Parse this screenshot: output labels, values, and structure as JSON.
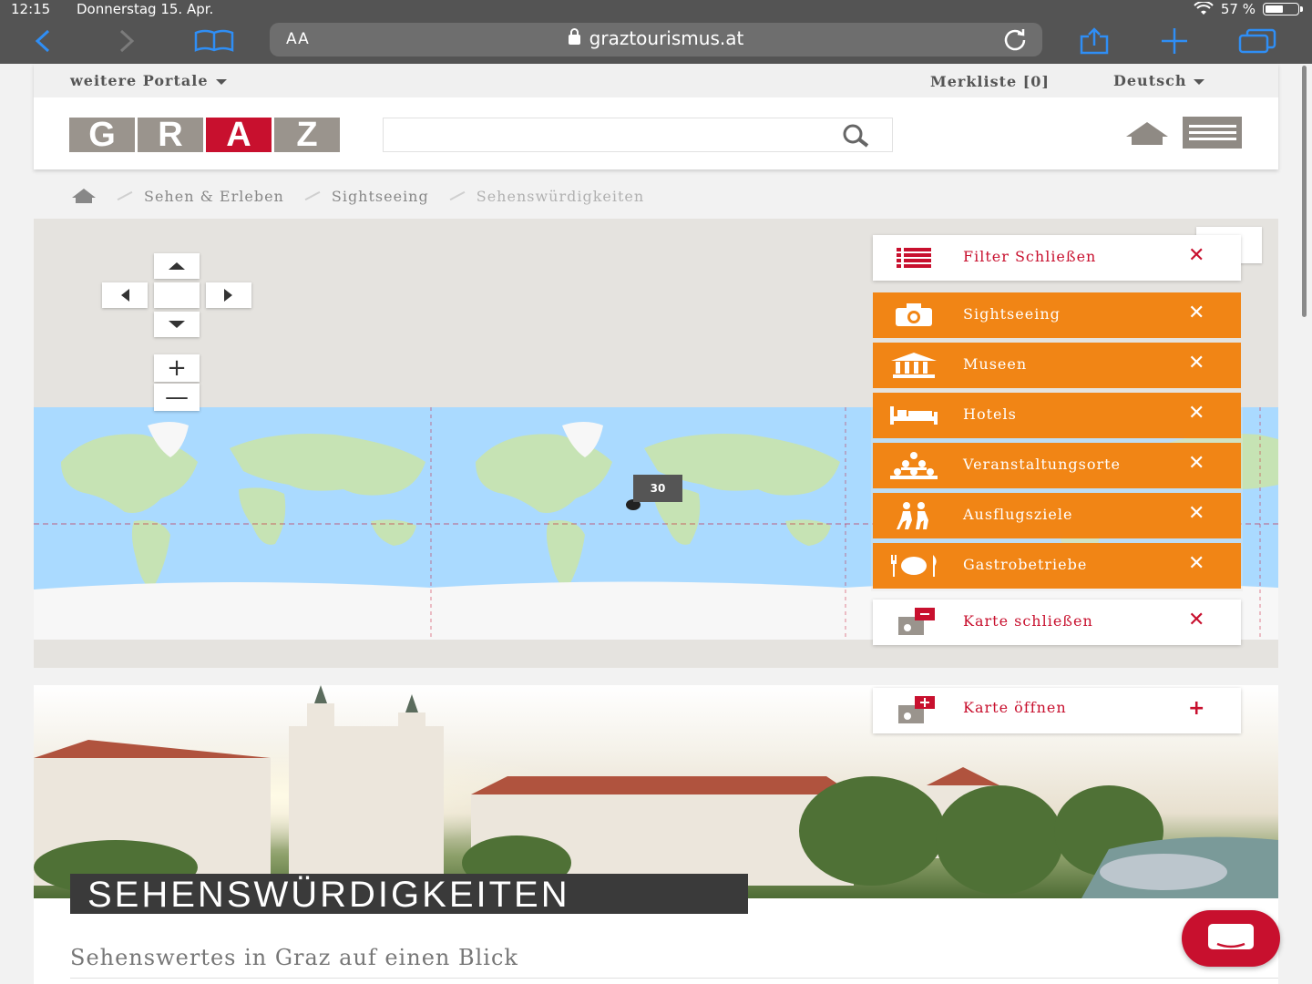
{
  "status_bar": {
    "time": "12:15",
    "date": "Donnerstag 15. Apr.",
    "battery": "57 %",
    "battery_level": 0.57
  },
  "browser": {
    "text_size_label": "AA",
    "url": "graztourismus.at"
  },
  "header": {
    "portals_label": "weitere Portale",
    "wishlist_label": "Merkliste [0]",
    "language_label": "Deutsch",
    "logo_letters": [
      "G",
      "R",
      "A",
      "Z"
    ],
    "search_placeholder": ""
  },
  "breadcrumb": {
    "items": [
      "Sehen & Erleben",
      "Sightseeing",
      "Sehenswürdigkeiten"
    ]
  },
  "map": {
    "cluster_count": "30",
    "zoom_in": "+",
    "zoom_out": "—"
  },
  "filter_panel": {
    "close_filter_label": "Filter Schließen",
    "categories": [
      {
        "label": "Sightseeing",
        "icon": "camera-icon"
      },
      {
        "label": "Museen",
        "icon": "museum-icon"
      },
      {
        "label": "Hotels",
        "icon": "bed-icon"
      },
      {
        "label": "Veranstaltungsorte",
        "icon": "audience-icon"
      },
      {
        "label": "Ausflugsziele",
        "icon": "hikers-icon"
      },
      {
        "label": "Gastrobetriebe",
        "icon": "dining-icon"
      }
    ],
    "close_map_label": "Karte schließen",
    "open_map_label": "Karte öffnen",
    "remove_symbol": "✕",
    "add_symbol": "+"
  },
  "content": {
    "hero_title": "SEHENSWÜRDIGKEITEN",
    "subtitle": "Sehenswertes in Graz auf einen Blick"
  },
  "colors": {
    "brand_red": "#c8102e",
    "category_orange": "#f18515",
    "logo_grey": "#9a948d"
  }
}
